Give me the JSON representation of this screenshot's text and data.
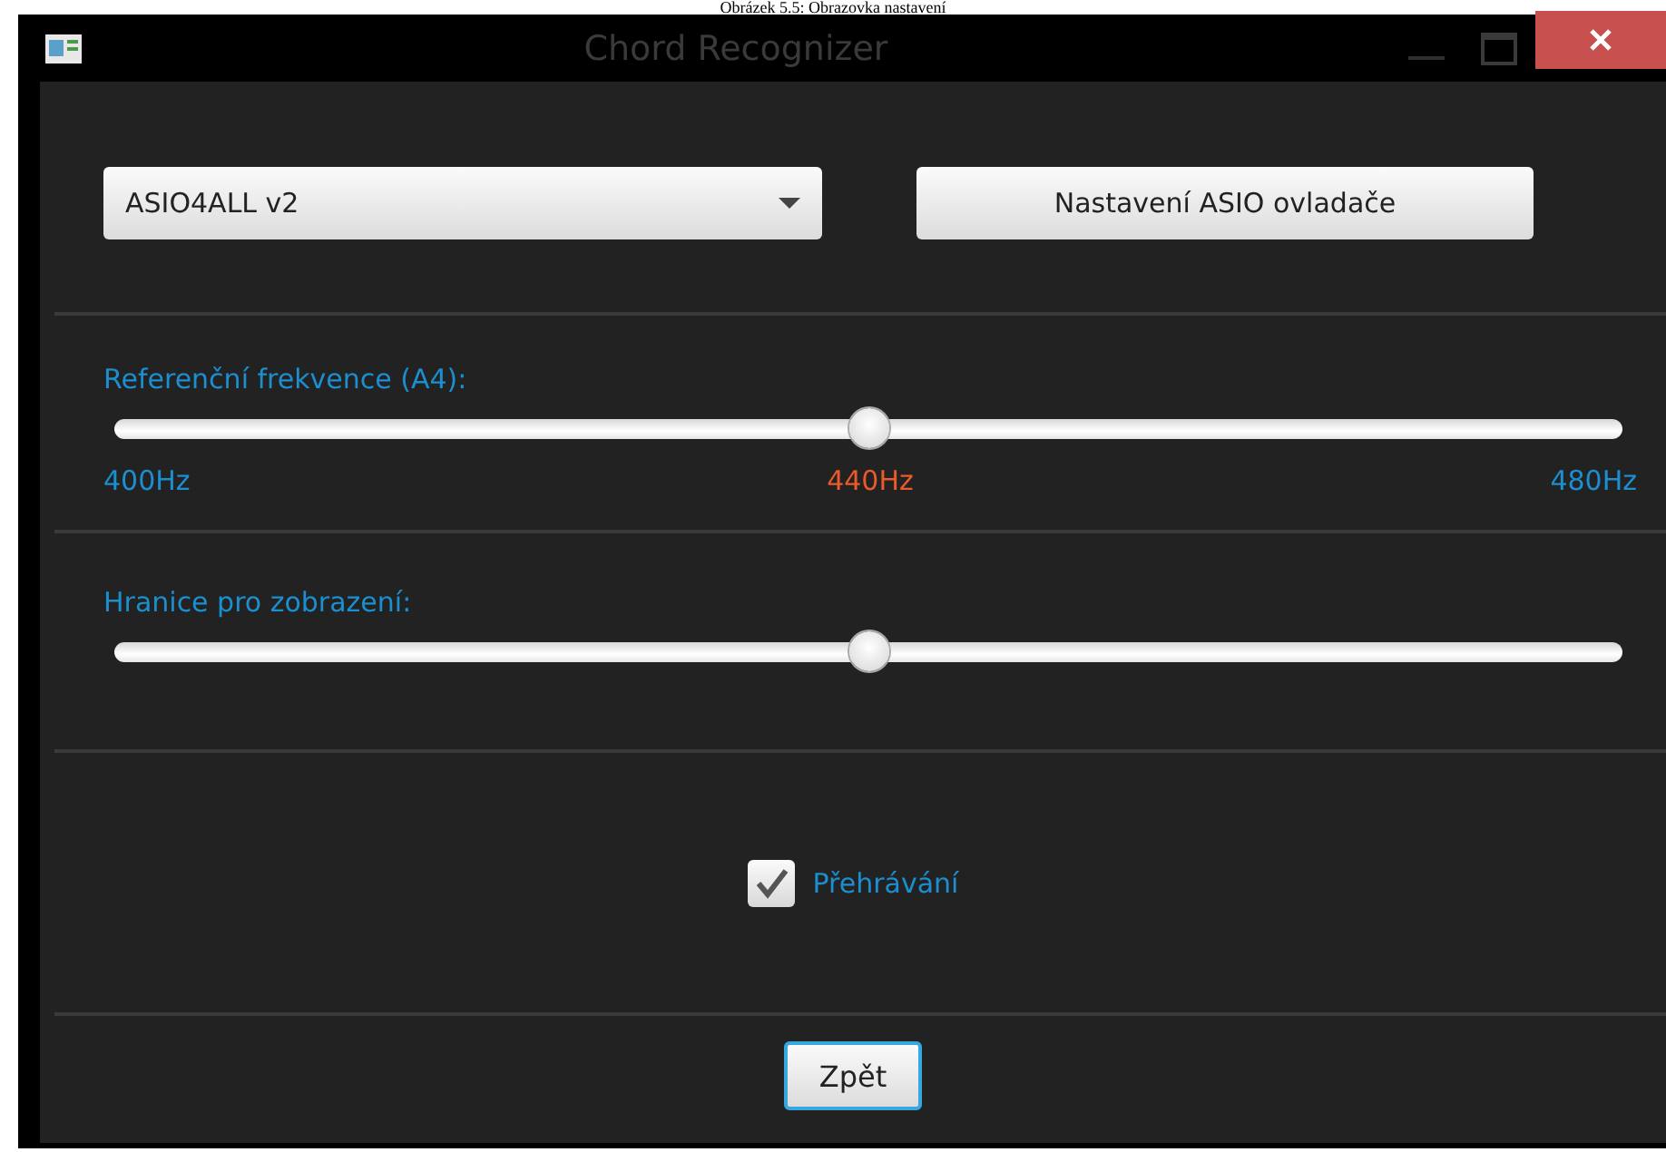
{
  "caption": "Obrázek 5.5: Obrazovka nastavení",
  "window": {
    "title": "Chord Recognizer"
  },
  "device_select": {
    "value": "ASIO4ALL v2"
  },
  "driver_settings_button": {
    "label": "Nastavení ASIO ovladače"
  },
  "sliders": [
    {
      "label": "Referenční frekvence (A4):",
      "level": 0.5,
      "ticks": [
        {
          "text": "400Hz",
          "selected": false
        },
        {
          "text": "440Hz",
          "selected": true
        },
        {
          "text": "480Hz",
          "selected": false
        }
      ]
    },
    {
      "label": "Hranice pro zobrazení:",
      "level": 0.5
    }
  ],
  "playback_checkbox": {
    "label": "Přehrávání",
    "checked": true
  },
  "back_button": {
    "label": "Zpět"
  }
}
